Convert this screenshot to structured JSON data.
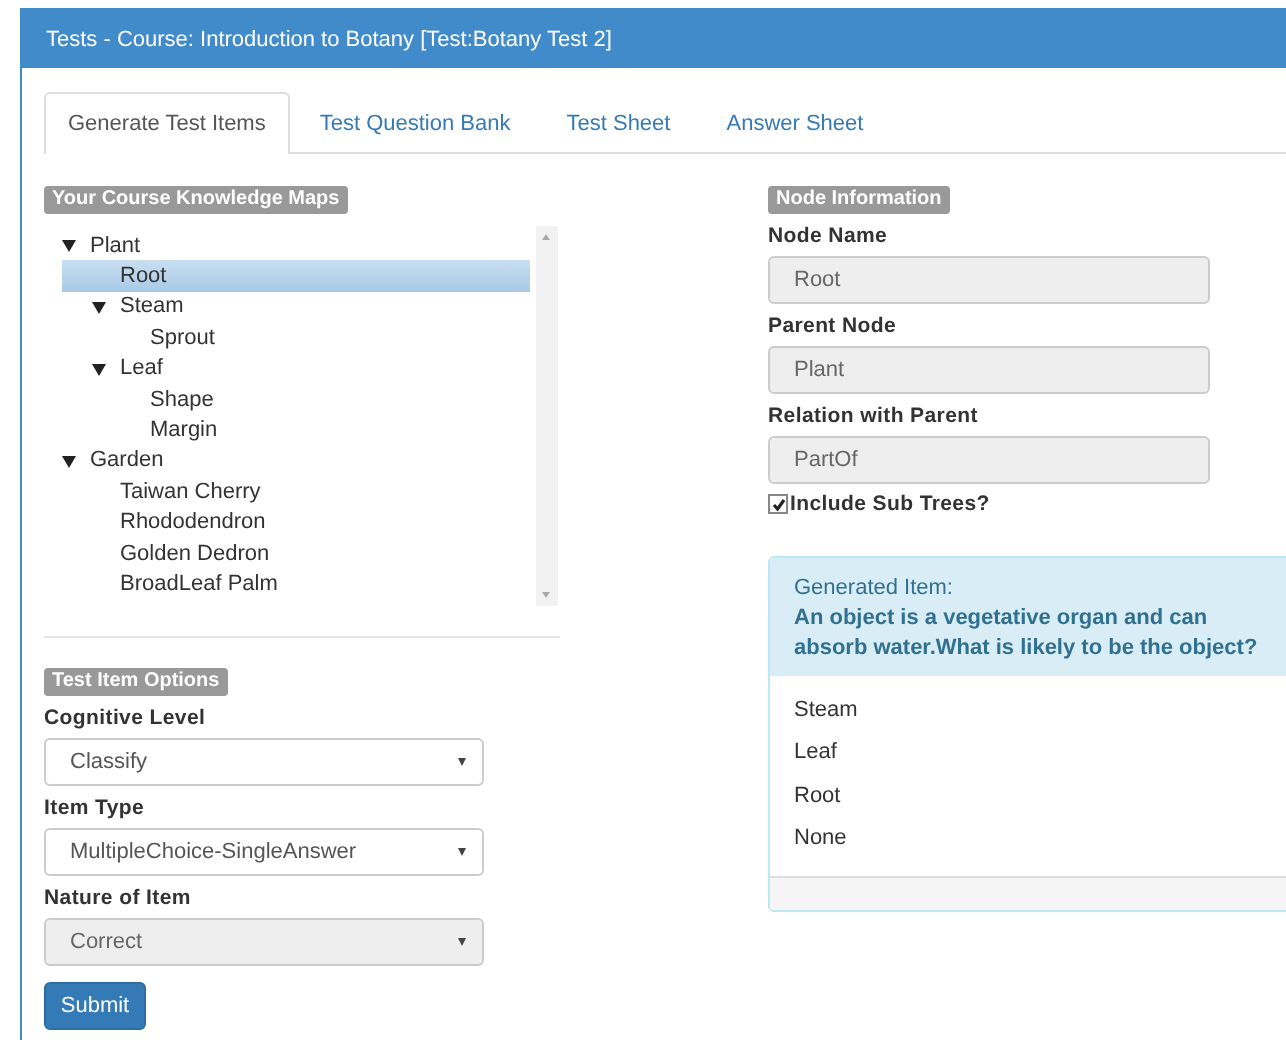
{
  "window": {
    "title": "Tests - Course: Introduction to Botany [Test:Botany Test 2]"
  },
  "tabs": [
    {
      "label": "Generate Test Items",
      "selected": true
    },
    {
      "label": "Test Question Bank",
      "selected": false
    },
    {
      "label": "Test Sheet",
      "selected": false
    },
    {
      "label": "Answer Sheet",
      "selected": false
    }
  ],
  "knowledge_maps": {
    "heading": "Your Course Knowledge Maps",
    "tree": [
      {
        "label": "Plant",
        "expanded": true,
        "selected": false,
        "children": [
          {
            "label": "Root",
            "selected": true
          },
          {
            "label": "Steam",
            "expanded": true,
            "selected": false,
            "children": [
              {
                "label": "Sprout",
                "selected": false
              }
            ]
          },
          {
            "label": "Leaf",
            "expanded": true,
            "selected": false,
            "children": [
              {
                "label": "Shape",
                "selected": false
              },
              {
                "label": "Margin",
                "selected": false
              }
            ]
          }
        ]
      },
      {
        "label": "Garden",
        "expanded": true,
        "selected": false,
        "children": [
          {
            "label": "Taiwan Cherry",
            "selected": false
          },
          {
            "label": "Rhododendron",
            "selected": false
          },
          {
            "label": "Golden Dedron",
            "selected": false
          },
          {
            "label": "BroadLeaf Palm",
            "selected": false
          }
        ]
      }
    ]
  },
  "test_item_options": {
    "heading": "Test Item Options",
    "fields": [
      {
        "label": "Cognitive Level",
        "value": "Classify",
        "disabled": false
      },
      {
        "label": "Item Type",
        "value": "MultipleChoice-SingleAnswer",
        "disabled": false
      },
      {
        "label": "Nature of Item",
        "value": "Correct",
        "disabled": true
      }
    ],
    "submit": "Submit"
  },
  "node_information": {
    "heading": "Node Information",
    "fields": [
      {
        "label": "Node Name",
        "value": "Root",
        "disabled": true
      },
      {
        "label": "Parent Node",
        "value": "Plant",
        "disabled": true
      },
      {
        "label": "Relation with Parent",
        "value": "PartOf",
        "disabled": true
      }
    ],
    "include_sub_trees": {
      "label": "Include Sub Trees?",
      "checked": true
    }
  },
  "generated_item": {
    "heading": "Generated Item:",
    "question": "An object is a vegetative organ and can absorb water.What is likely to be the object?",
    "options": [
      "Steam",
      "Leaf",
      "Root",
      "None"
    ]
  }
}
